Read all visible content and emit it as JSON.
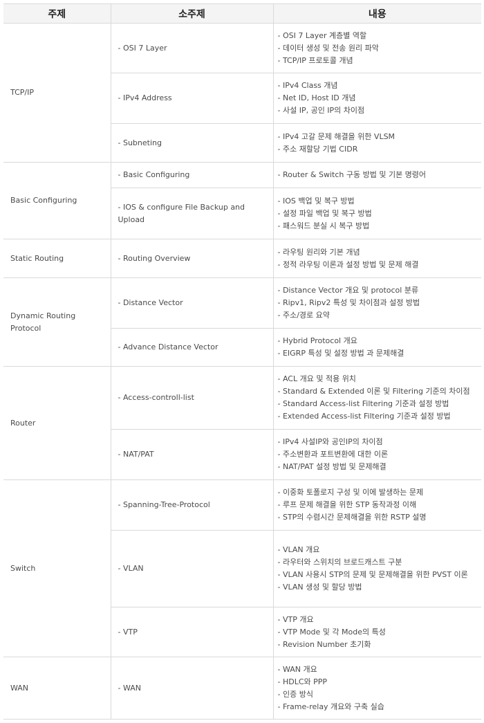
{
  "headers": {
    "topic": "주제",
    "subtopic": "소주제",
    "content": "내용"
  },
  "rows": [
    {
      "topic": "TCP/IP",
      "subs": [
        {
          "label": "- OSI 7 Layer",
          "items": [
            " - OSI 7 Layer 계층별 역할",
            "- 데이터 생성 및 전송 원리 파악",
            "- TCP/IP 프로토콜 개념"
          ]
        },
        {
          "label": "- IPv4 Address",
          "items": [
            "- IPv4 Class 개념",
            "- Net ID, Host ID 개념",
            "- 사설 IP, 공인 IP의 차이점"
          ]
        },
        {
          "label": "- Subneting",
          "items": [
            "- IPv4 고갈 문제 해결을 위한 VLSM",
            "- 주소 재할당 기법 CIDR"
          ]
        }
      ]
    },
    {
      "topic": "Basic Configuring",
      "subs": [
        {
          "label": "- Basic Configuring",
          "items": [
            "- Router & Switch 구동 방법 및 기본 명령어"
          ]
        },
        {
          "label": "- IOS & configure File Backup and Upload",
          "items": [
            "- IOS 백업 및 복구 방법",
            "- 설정 파일 백업 및 복구 방법",
            "- 패스워드 분실 시 복구 방법"
          ]
        }
      ]
    },
    {
      "topic": "Static Routing",
      "subs": [
        {
          "label": "- Routing Overview",
          "items": [
            "- 라우팅 원리와 기본 개념",
            "- 정적 라우팅 이론과 설정 방법 및 문제 해결"
          ]
        }
      ]
    },
    {
      "topic": "Dynamic Routing Protocol",
      "subs": [
        {
          "label": "- Distance Vector",
          "items": [
            "- Distance Vector 개요 및 protocol 분류",
            "- Ripv1, Ripv2 특성 및 차이점과 설정 방법",
            "- 주소/경로 요약"
          ]
        },
        {
          "label": "- Advance Distance Vector",
          "items": [
            "- Hybrid Protocol 개요",
            "- EIGRP 특성 및 설정 방법 과 문제해결"
          ]
        }
      ]
    },
    {
      "topic": "Router",
      "subs": [
        {
          "label": "- Access-controll-list",
          "items": [
            "- ACL 개요 및 적용 위치",
            "- Standard & Extended 이론 및 Filtering 기준의 차이점",
            "- Standard Access-list Filtering 기준과 설정 방법",
            "- Extended Access-list Filtering 기준과 설정 방법"
          ]
        },
        {
          "label": "- NAT/PAT",
          "items": [
            "- IPv4 사설IP와 공인IP의 차이점",
            "- 주소변환과 포트변환에 대한 이론",
            "- NAT/PAT 설정 방법 및 문제해결"
          ]
        }
      ]
    },
    {
      "topic": "Switch",
      "subs": [
        {
          "label": "- Spanning-Tree-Protocol",
          "items": [
            "- 이중화 토폴로지 구성 및 이에 발생하는 문제",
            "- 루프 문제 해결을 위한 STP 동작과정 이해",
            "- STP의 수렴시간 문제해결을 위한 RSTP 설명"
          ]
        },
        {
          "label": "- VLAN",
          "items": [
            "- VLAN 개요",
            "- 라우터와 스위치의 브로드캐스트 구분",
            "- VLAN 사용시 STP의 문제 및 문제해결을 위한 PVST 이론",
            "- VLAN 생성 및 할당 방법"
          ]
        },
        {
          "label": "- VTP",
          "items": [
            "- VTP 개요",
            "- VTP Mode 및 각 Mode의 특성",
            "- Revision Number 초기화"
          ]
        }
      ]
    },
    {
      "topic": "WAN",
      "subs": [
        {
          "label": "- WAN",
          "items": [
            "- WAN 개요",
            "- HDLC와 PPP",
            "- 인증 방식",
            "- Frame-relay 개요와 구축 실습"
          ]
        }
      ]
    }
  ]
}
